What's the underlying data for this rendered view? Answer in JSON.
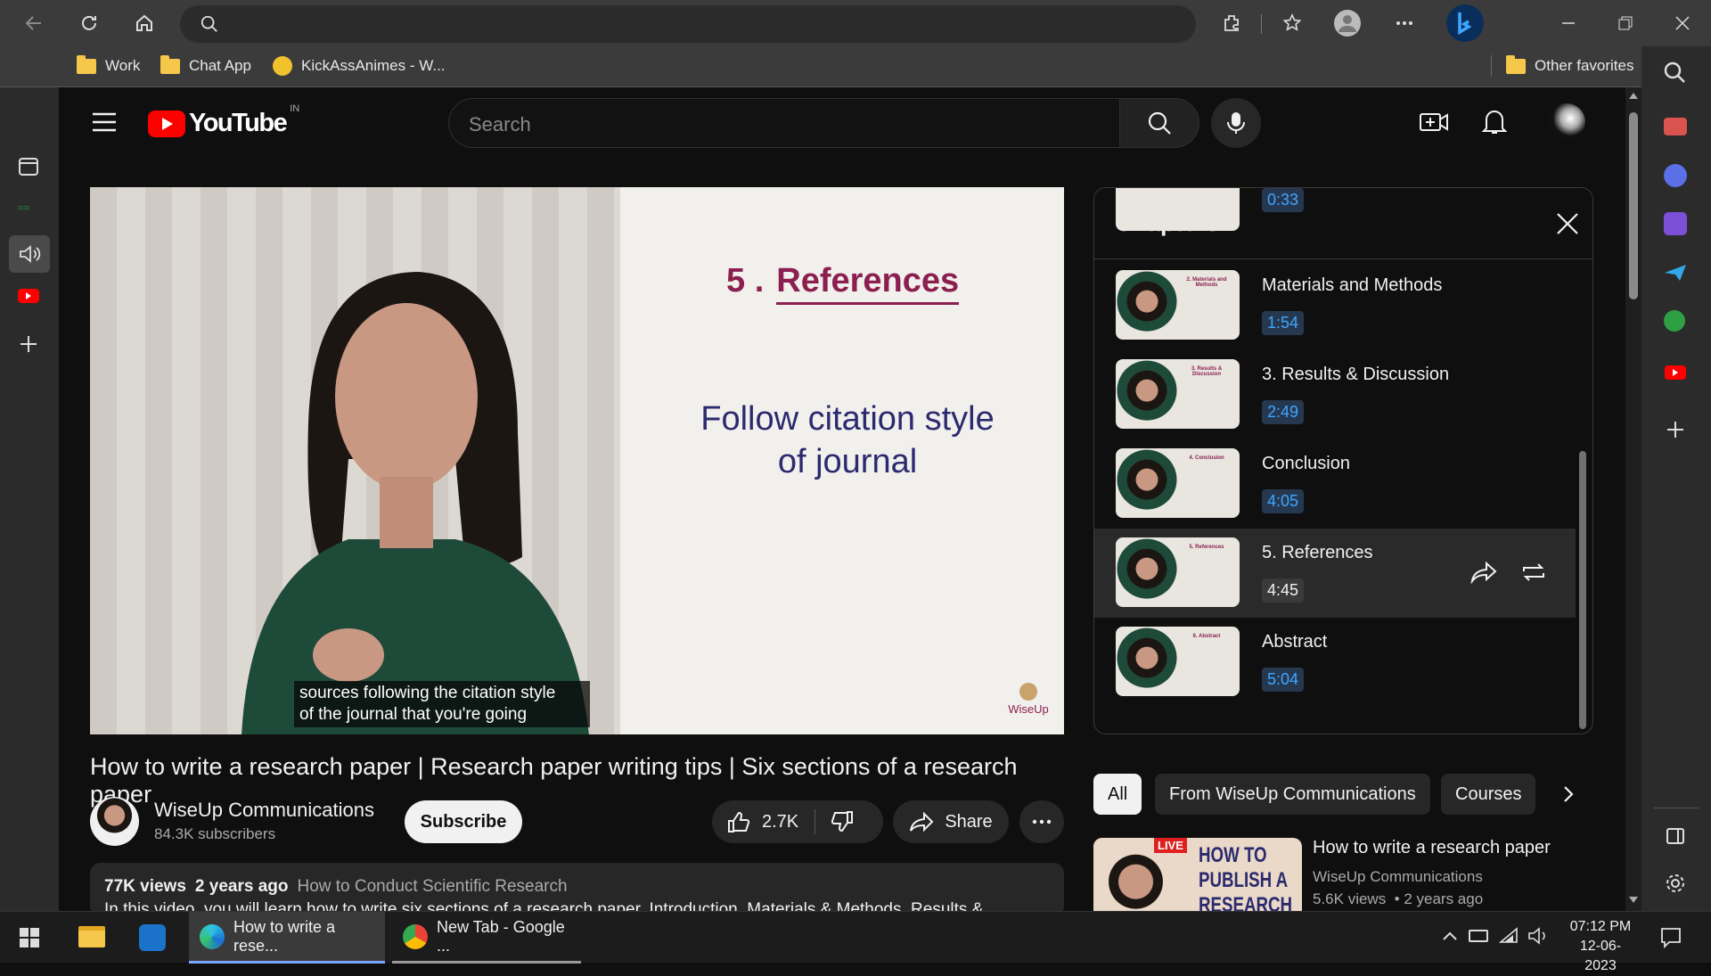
{
  "browser": {
    "favorites": [
      {
        "label": "Work"
      },
      {
        "label": "Chat App"
      },
      {
        "label": "KickAssAnimes - W..."
      }
    ],
    "other_favorites": "Other favorites"
  },
  "youtube": {
    "logo_text": "YouTube",
    "region": "IN",
    "search_placeholder": "Search"
  },
  "video": {
    "slide_heading_number": "5 .",
    "slide_heading": "References",
    "slide_body": [
      "Follow citation style",
      "of journal"
    ],
    "watermark": "WiseUp",
    "caption_lines": [
      "sources following the citation style",
      "of the journal that you're going"
    ],
    "title": "How to write a research paper | Research paper writing tips | Six sections of a research paper",
    "channel": "WiseUp Communications",
    "subscribers": "84.3K subscribers",
    "subscribe_label": "Subscribe",
    "likes": "2.7K",
    "share_label": "Share",
    "views": "77K views",
    "age": "2 years ago",
    "playlist_link": "How to Conduct Scientific Research",
    "description_snippet": "In this video, you will learn how to write six sections of a research paper. Introduction, Materials & Methods, Results &"
  },
  "chapters": {
    "header": "Chapters",
    "partial_time": "0:33",
    "items": [
      {
        "title": "Materials and Methods",
        "time": "1:54",
        "thumb_heading": "2. Materials and Methods"
      },
      {
        "title": "3. Results & Discussion",
        "time": "2:49",
        "thumb_heading": "3. Results & Discussion"
      },
      {
        "title": "Conclusion",
        "time": "4:05",
        "thumb_heading": "4. Conclusion"
      },
      {
        "title": "5. References",
        "time": "4:45",
        "thumb_heading": "5. References"
      },
      {
        "title": "Abstract",
        "time": "5:04",
        "thumb_heading": "6. Abstract"
      }
    ],
    "active_index": 3
  },
  "filters": {
    "chips": [
      "All",
      "From WiseUp Communications",
      "Courses"
    ]
  },
  "recommendation": {
    "title": "How to write a research paper",
    "channel": "WiseUp Communications",
    "meta": "5.6K views  • 2 years ago",
    "thumb_text": [
      "HOW TO",
      "PUBLISH A",
      "RESEARCH"
    ],
    "live_badge": "LIVE"
  },
  "taskbar": {
    "tasks": [
      {
        "label": "How to write a rese..."
      },
      {
        "label": "New Tab - Google ..."
      }
    ],
    "time": "07:12 PM",
    "date": "12-06-2023"
  },
  "colors": {
    "youtube_red": "#ff0000",
    "chapter_time_blue": "#3ea6ff",
    "slide_accent": "#8b1f4f",
    "slide_text": "#2b2a6e"
  }
}
